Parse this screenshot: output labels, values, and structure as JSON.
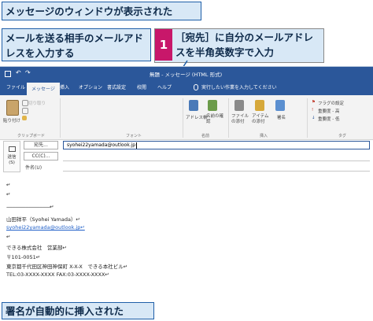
{
  "callouts": {
    "top": "メッセージのウィンドウが表示された",
    "left": "メールを送る相手のメールアドレスを入力する",
    "step_number": "1",
    "step": "［宛先］に自分のメールアドレスを半角英数字で入力",
    "bottom": "署名が自動的に挿入された"
  },
  "window": {
    "title": "無題 - メッセージ (HTML 形式)",
    "tabs": [
      "ファイル",
      "メッセージ",
      "挿入",
      "オプション",
      "書式設定",
      "校閲",
      "ヘルプ"
    ],
    "tell_me": "実行したい作業を入力してください"
  },
  "ribbon": {
    "paste": "貼り付け",
    "cut": "切り取り",
    "clipboard_group": "クリップボード",
    "font_group": "フォント",
    "address_book": "アドレス帳",
    "check_names": "名前の確認",
    "names_group": "名前",
    "attach_file": "ファイルの添付",
    "attach_item": "アイテムの添付",
    "signature": "署名",
    "include_group": "挿入",
    "followup": "フラグの設定",
    "high_importance": "重要度 - 高",
    "low_importance": "重要度 - 低",
    "tags_group": "タグ"
  },
  "compose": {
    "send_label": "送信(S)",
    "to_button": "宛先...",
    "to_value": "syohei22yamada@outlook.jp",
    "cc_button": "CC(C)...",
    "subject_label": "件名(U)"
  },
  "signature_lines": [
    "↵",
    "↵",
    "-----------------------------------------↵",
    "山田祥平（Syohei Yamada）↵",
    "syohei22yamada@outlook.jp↵",
    "↵",
    "できる株式会社　営業部↵",
    "〒101-0051↵",
    "東京都千代田区神田神保町 X-X-X　できる本社ビル↵",
    "TEL:03-XXXX-XXXX FAX:03-XXXX-XXXX↵"
  ],
  "colors": {
    "accent": "#2b579a",
    "callout_bg": "#d8e8f6",
    "callout_border": "#1f5fa8",
    "step_badge": "#c8176a"
  }
}
